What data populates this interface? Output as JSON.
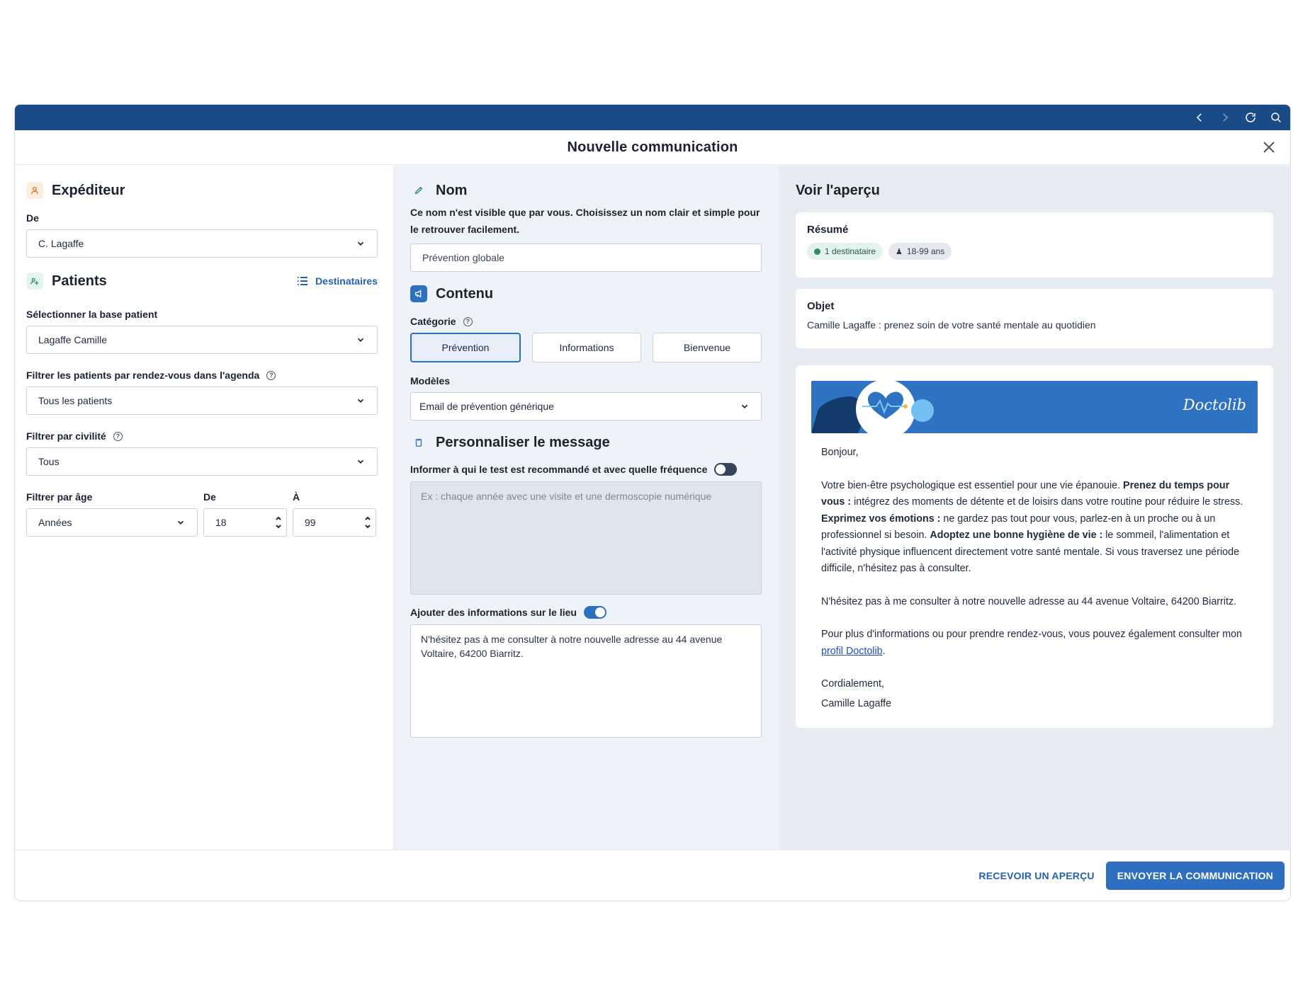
{
  "dialog": {
    "title": "Nouvelle communication"
  },
  "sender": {
    "title": "Expéditeur",
    "from_label": "De",
    "from_value": "C. Lagaffe"
  },
  "patients": {
    "title": "Patients",
    "recipients_link": "Destinataires",
    "base_label": "Sélectionner la base patient",
    "base_value": "Lagaffe Camille",
    "agenda_filter_label": "Filtrer les patients par rendez-vous dans l'agenda",
    "agenda_filter_value": "Tous les patients",
    "civility_label": "Filtrer par civilité",
    "civility_value": "Tous",
    "age_label": "Filtrer par âge",
    "age_unit_value": "Années",
    "from_label": "De",
    "from_value": "18",
    "to_label": "À",
    "to_value": "99"
  },
  "name_section": {
    "title": "Nom",
    "description": "Ce nom n'est visible que par vous. Choisissez un nom clair et simple pour le retrouver facilement.",
    "value": "Prévention globale"
  },
  "content": {
    "title": "Contenu",
    "category_label": "Catégorie",
    "categories": [
      "Prévention",
      "Informations",
      "Bienvenue"
    ],
    "active_category": "Prévention",
    "models_label": "Modèles",
    "model_value": "Email de prévention générique"
  },
  "customize": {
    "title": "Personnaliser le message",
    "frequency_label": "Informer à qui le test est recommandé et avec quelle fréquence",
    "frequency_enabled": false,
    "frequency_placeholder": "Ex : chaque année avec une visite et une dermoscopie numérique",
    "location_label": "Ajouter des informations sur le lieu",
    "location_enabled": true,
    "location_text": "N'hésitez pas à me consulter à notre nouvelle adresse au 44 avenue Voltaire, 64200 Biarritz."
  },
  "preview": {
    "title": "Voir l'aperçu",
    "summary_title": "Résumé",
    "recipients_tag": "1 destinataire",
    "age_tag": "18-99 ans",
    "object_title": "Objet",
    "object_text": "Camille Lagaffe : prenez soin de votre santé mentale au quotidien",
    "brand": "Doctolib",
    "greeting": "Bonjour,",
    "para1_a": "Votre bien-être psychologique est essentiel pour une vie épanouie. ",
    "para1_b": "Prenez du temps pour vous :",
    "para1_c": " intégrez des moments de détente et de loisirs dans votre routine pour réduire le stress. ",
    "para1_d": "Exprimez vos émotions :",
    "para1_e": " ne gardez pas tout pour vous, parlez-en à un proche ou à un professionnel si besoin. ",
    "para1_f": "Adoptez une bonne hygiène de vie :",
    "para1_g": " le sommeil, l'alimentation et l'activité physique influencent directement votre santé mentale. Si vous traversez une période difficile, n'hésitez pas à consulter.",
    "para2": "N'hésitez pas à me consulter à notre nouvelle adresse au 44 avenue Voltaire, 64200 Biarritz.",
    "para3_a": "Pour plus d'informations ou pour prendre rendez-vous, vous pouvez également consulter mon ",
    "para3_link": "profil Doctolib",
    "para3_b": ".",
    "closing": "Cordialement,",
    "signature": "Camille Lagaffe"
  },
  "footer": {
    "preview_button": "RECEVOIR UN APERÇU",
    "send_button": "ENVOYER LA COMMUNICATION"
  },
  "colors": {
    "topbar": "#1a4b87",
    "accent": "#2f6fbf",
    "banner": "#2e73c2"
  }
}
